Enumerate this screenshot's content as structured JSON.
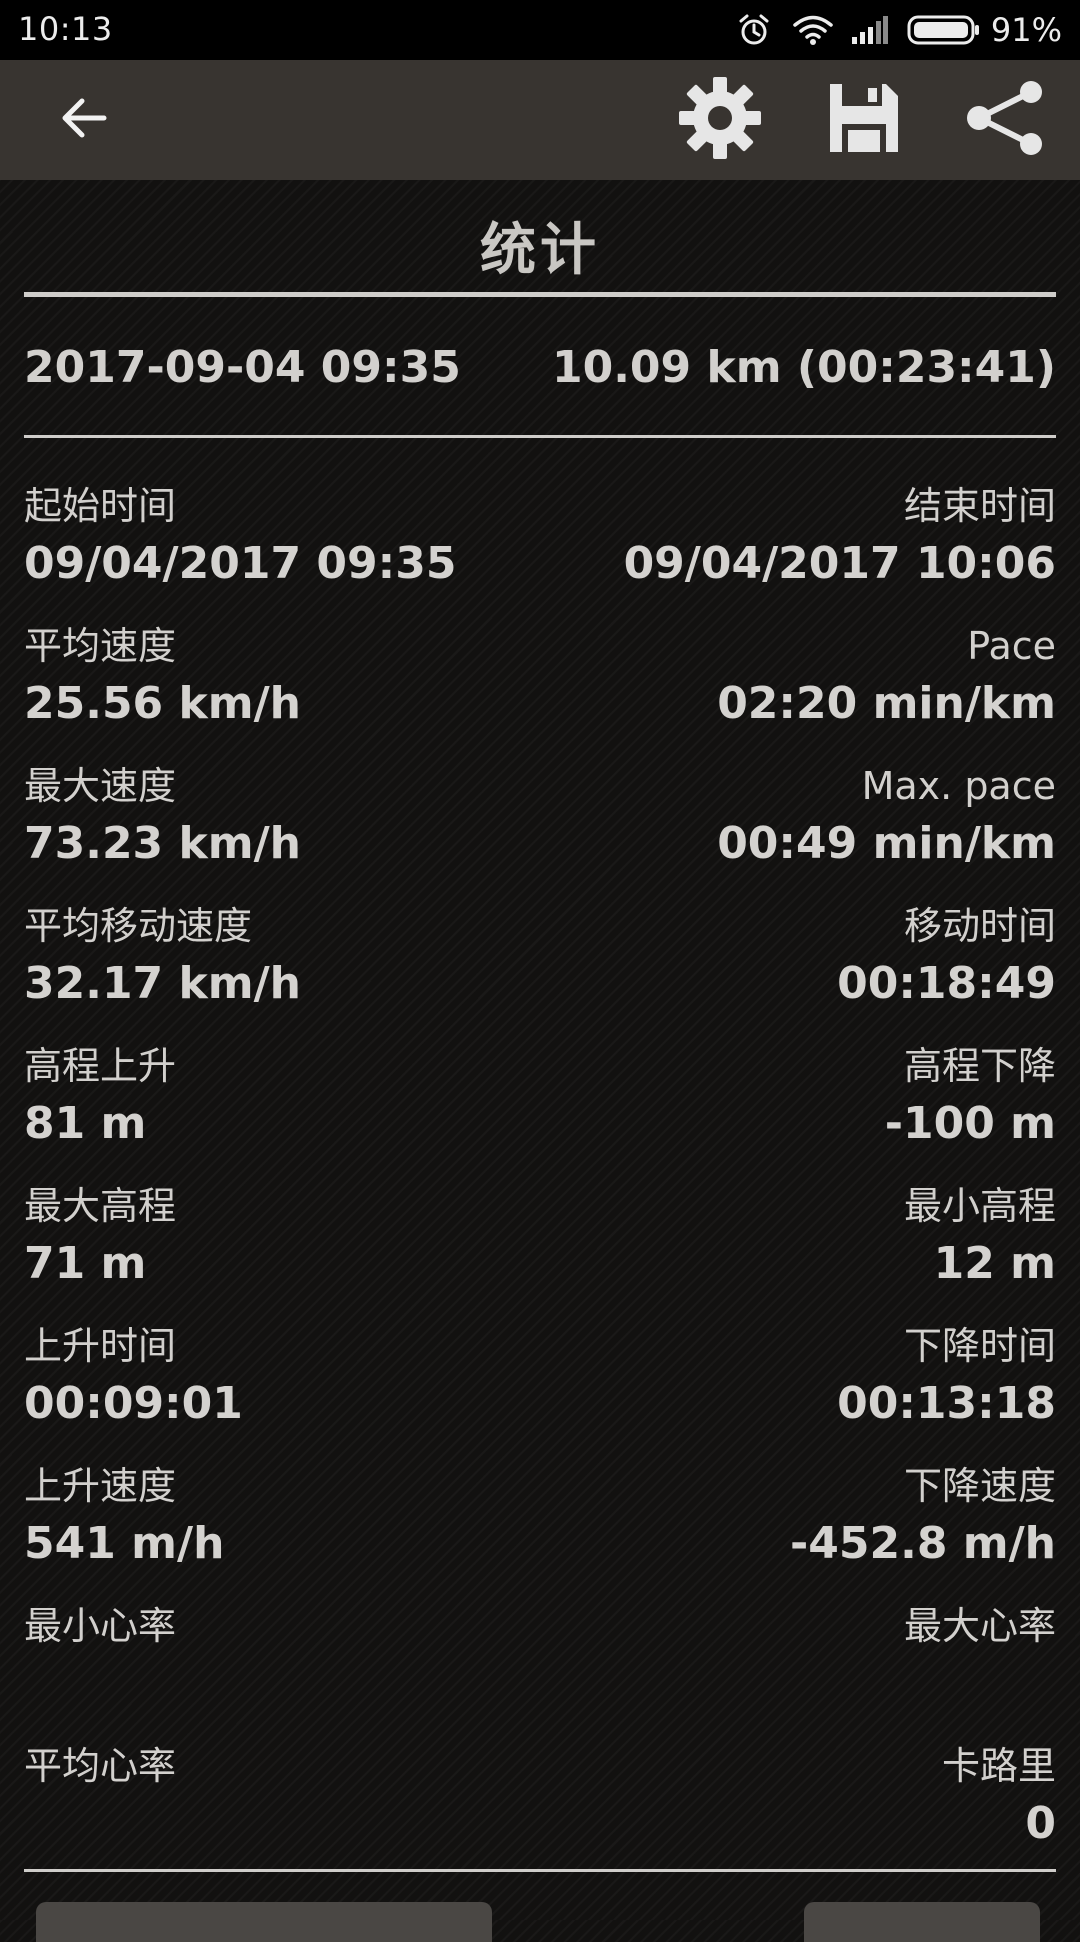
{
  "status_bar": {
    "time": "10:13",
    "battery": "91%",
    "icons": [
      "alarm-icon",
      "wifi-icon",
      "signal-icon",
      "battery-icon"
    ]
  },
  "toolbar": {
    "icons": [
      "back-arrow-icon",
      "gear-icon",
      "save-icon",
      "share-icon"
    ],
    "background": "#383430"
  },
  "header": {
    "title": "统计",
    "date": "2017-09-04 09:35",
    "summary": "10.09 km (00:23:41)"
  },
  "stats": [
    {
      "left": {
        "label": "起始时间",
        "value": "09/04/2017 09:35"
      },
      "right": {
        "label": "结束时间",
        "value": "09/04/2017 10:06"
      }
    },
    {
      "left": {
        "label": "平均速度",
        "value": "25.56 km/h"
      },
      "right": {
        "label": "Pace",
        "value": "02:20 min/km"
      }
    },
    {
      "left": {
        "label": "最大速度",
        "value": "73.23 km/h"
      },
      "right": {
        "label": "Max. pace",
        "value": "00:49 min/km"
      }
    },
    {
      "left": {
        "label": "平均移动速度",
        "value": "32.17 km/h"
      },
      "right": {
        "label": "移动时间",
        "value": "00:18:49"
      }
    },
    {
      "left": {
        "label": "高程上升",
        "value": "81 m"
      },
      "right": {
        "label": "高程下降",
        "value": "-100 m"
      }
    },
    {
      "left": {
        "label": "最大高程",
        "value": "71 m"
      },
      "right": {
        "label": "最小高程",
        "value": "12 m"
      }
    },
    {
      "left": {
        "label": "上升时间",
        "value": "00:09:01"
      },
      "right": {
        "label": "下降时间",
        "value": "00:13:18"
      }
    },
    {
      "left": {
        "label": "上升速度",
        "value": "541 m/h"
      },
      "right": {
        "label": "下降速度",
        "value": "-452.8 m/h"
      }
    },
    {
      "left": {
        "label": "最小心率",
        "value": ""
      },
      "right": {
        "label": "最大心率",
        "value": ""
      }
    },
    {
      "left": {
        "label": "平均心率",
        "value": ""
      },
      "right": {
        "label": "卡路里",
        "value": "0"
      }
    }
  ]
}
